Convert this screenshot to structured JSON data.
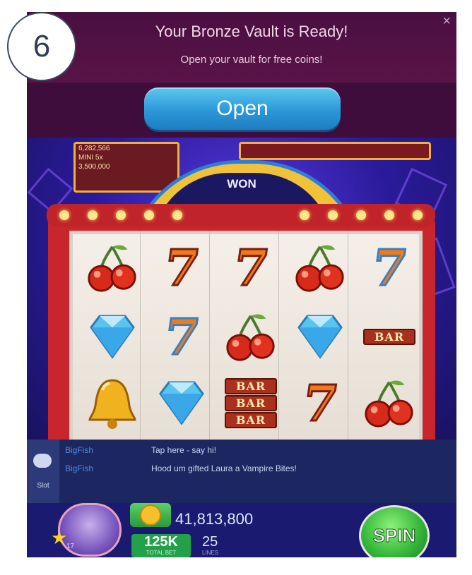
{
  "step_badge": "6",
  "banner": {
    "title": "Your Bronze Vault is Ready!",
    "subtitle": "Open your vault for free coins!",
    "open_label": "Open",
    "close_glyph": "×"
  },
  "machine": {
    "won_label": "WON",
    "jackpots": [
      "6,282,566",
      "MINI 5x",
      "3,500,000"
    ],
    "reels": [
      [
        "cherry",
        "seven",
        "seven",
        "cherry",
        "seven-blue"
      ],
      [
        "diamond",
        "seven-blue",
        "cherry",
        "diamond",
        "bar"
      ],
      [
        "bell",
        "diamond",
        "triple-bar",
        "seven",
        "cherry"
      ]
    ],
    "bar_text": "BAR"
  },
  "chat": {
    "label": "Slot",
    "messages": [
      {
        "name": "BigFish",
        "text": "Tap here - say hi!"
      },
      {
        "name": "BigFish",
        "text": "Hood um gifted Laura a Vampire Bites!"
      }
    ]
  },
  "footer": {
    "coins": "41,813,800",
    "level_value": "125K",
    "level_caption": "TOTAL BET",
    "lines_value": "25",
    "lines_caption": "LINES",
    "player_level": "17",
    "spin_label": "SPIN"
  },
  "colors": {
    "banner": "#4a0f42",
    "open_button": "#2b98d8",
    "cabinet": "#c9252d",
    "spin": "#36b83a"
  }
}
